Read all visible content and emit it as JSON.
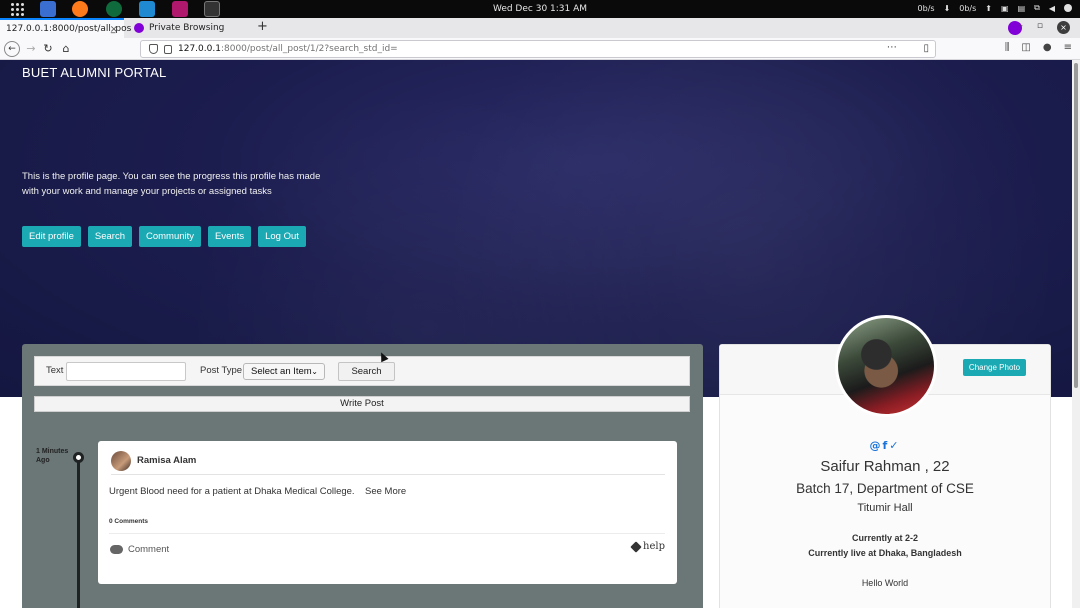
{
  "os_topbar": {
    "clock": "Wed Dec 30   1:31 AM",
    "net_down": "0b/s",
    "net_up": "0b/s"
  },
  "browser": {
    "tabs": [
      {
        "label": "127.0.0.1:8000/post/all_pos"
      },
      {
        "label": "Private Browsing"
      }
    ],
    "url_host": "127.0.0.1",
    "url_rest": ":8000/post/all_post/1/2?search_std_id="
  },
  "hero": {
    "brand": "BUET ALUMNI PORTAL",
    "description": "This is the profile page. You can see the progress this profile has made with your work and manage your projects or assigned tasks",
    "buttons": [
      {
        "label": "Edit profile"
      },
      {
        "label": "Search"
      },
      {
        "label": "Community"
      },
      {
        "label": "Events"
      },
      {
        "label": "Log Out"
      }
    ]
  },
  "feed": {
    "search": {
      "text_label": "Text",
      "text_value": "",
      "type_label": "Post Type",
      "type_selected": "Select an Item",
      "search_button": "Search"
    },
    "write_post": "Write Post",
    "posts": [
      {
        "time": "1 Minutes Ago",
        "author": "Ramisa Alam",
        "body": "Urgent Blood need for a patient at Dhaka Medical College.",
        "see_more": "See More",
        "comments_count": "0 Comments",
        "comment_action": "Comment",
        "tag": "help"
      }
    ]
  },
  "profile": {
    "change_photo": "Change Photo",
    "socials": "@ f ✓",
    "name": "Saifur Rahman , 22",
    "batch": "Batch 17, Department of CSE",
    "hall": "Titumir Hall",
    "current": "Currently at 2-2",
    "lives": "Currently live at Dhaka, Bangladesh",
    "bio": "Hello World"
  },
  "colors": {
    "accent": "#1ba9b3",
    "hero_bg": "#1c1d4f",
    "feed_bg": "#6b7676",
    "social": "#1a73d9"
  }
}
